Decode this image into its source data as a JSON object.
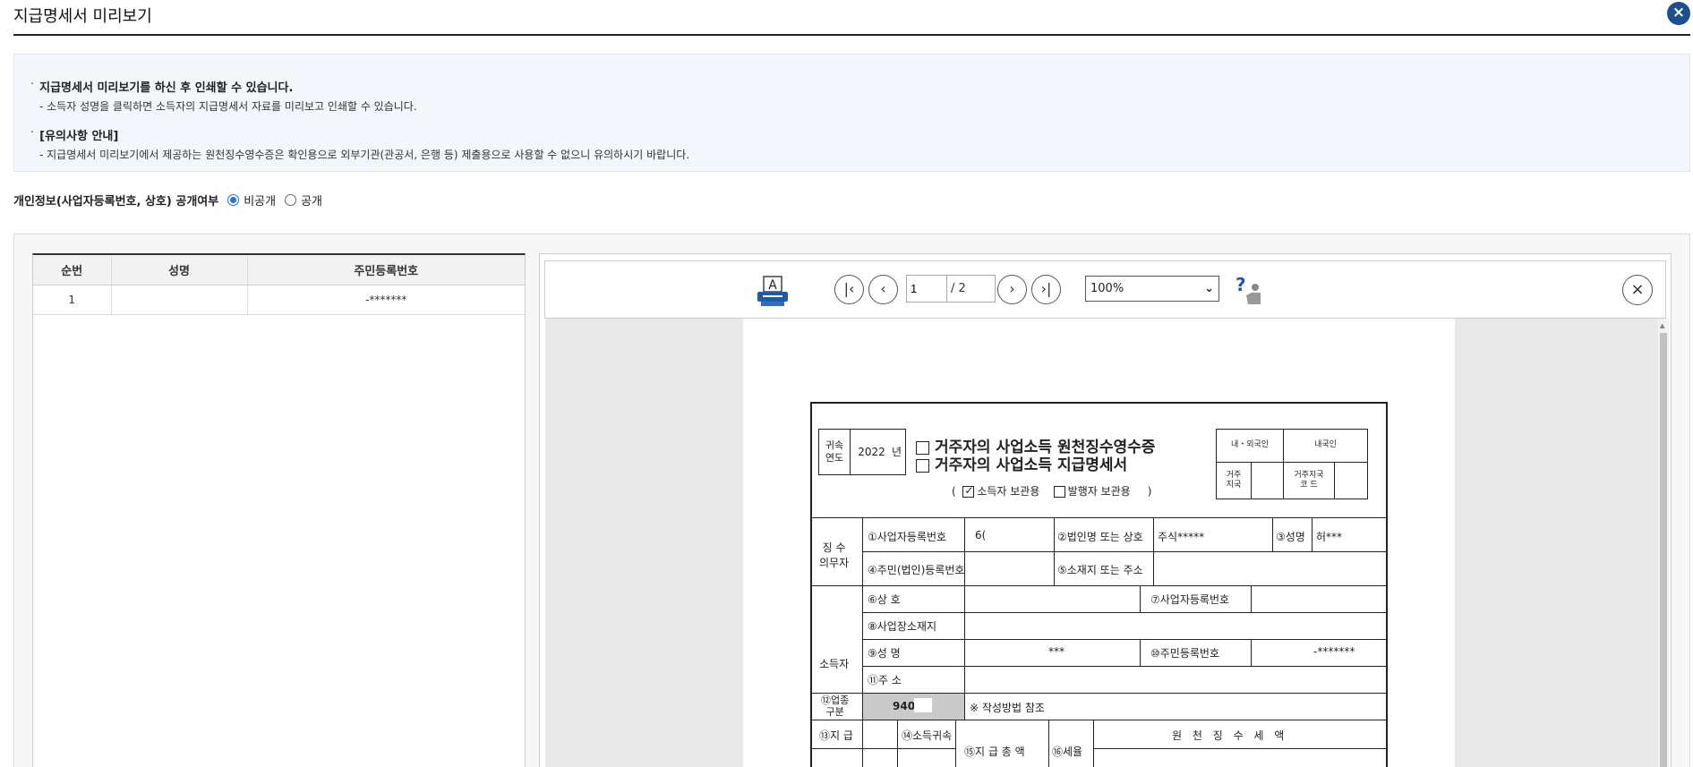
{
  "window": {
    "title": "지급명세서 미리보기",
    "close_glyph": "×"
  },
  "notice": {
    "items": [
      {
        "head": "지급명세서 미리보기를 하신 후 인쇄할 수 있습니다.",
        "sub": "- 소득자 성명을 클릭하면 소득자의 지급명세서 자료를 미리보고 인쇄할 수 있습니다."
      },
      {
        "head": "[유의사항 안내]",
        "sub": "- 지급명세서 미리보기에서 제공하는 원천징수영수증은 확인용으로 외부기관(관공서, 은행 등) 제출용으로 사용할 수 없으니 유의하시기 바랍니다."
      }
    ],
    "bullet": "·"
  },
  "privacy": {
    "label": "개인정보(사업자등록번호, 상호) 공개여부",
    "options": [
      {
        "label": "비공개",
        "selected": true
      },
      {
        "label": "공개",
        "selected": false
      }
    ]
  },
  "list": {
    "columns": [
      "순번",
      "성명",
      "주민등록번호"
    ],
    "rows": [
      {
        "no": "1",
        "name": "",
        "rrn": "-*******"
      }
    ]
  },
  "viewer": {
    "page_current": "1",
    "page_total": "/ 2",
    "zoom": "100%",
    "icons": [
      "printer-icon",
      "first-page-icon",
      "prev-page-icon",
      "next-page-icon",
      "last-page-icon",
      "help-icon",
      "close-icon"
    ],
    "nav_glyphs": {
      "first": "|‹",
      "prev": "‹",
      "next": "›",
      "last": "›|",
      "close": "×",
      "dropdown": "⌄",
      "scroll_up": "▲"
    }
  },
  "doc": {
    "year_label": "귀속\n연도",
    "year": "2022",
    "year_unit": "년",
    "title1": "거주자의 사업소득 원천징수영수증",
    "title2": "거주자의 사업소득 지급명세서",
    "paren_open": "(",
    "paren_close": ")",
    "copy_income": "소득자 보관용",
    "copy_payer": "발행자 보관용",
    "foreign_label": "내・외국인",
    "foreign_value": "내국인",
    "resident_label": "거주\n지국",
    "resident_code_label": "거주지국\n코 드",
    "withholder_label": "징 수\n의무자",
    "biz_no_label": "①사업자등록번호",
    "biz_no_value": "6(",
    "corp_name_label": "②법인명 또는 상호",
    "corp_name_value": "주식*****",
    "name_label": "③성명",
    "name_value": "허***",
    "corp_rrn_label": "④주민(법인)등록번호",
    "address_label": "⑤소재지 또는 주소",
    "earner_label": "소득자",
    "trade_name_label": "⑥상 호",
    "earner_biz_no_label": "⑦사업자등록번호",
    "biz_address_label": "⑧사업장소재지",
    "earner_name_label": "⑨성 명",
    "earner_name_value": "***",
    "earner_rrn_label": "⑩주민등록번호",
    "earner_rrn_value": "-*******",
    "earner_addr_label": "⑪주 소",
    "industry_label": "⑫업종\n구분",
    "industry_value": "940",
    "industry_note": "※ 작성방법 참조",
    "pay_label": "⑬지 급",
    "period_label": "⑭소득귀속",
    "total_label": "⑮지 급 총 액",
    "rate_label": "⑯세율",
    "tax_label": "원 천 징 수 세 액"
  }
}
